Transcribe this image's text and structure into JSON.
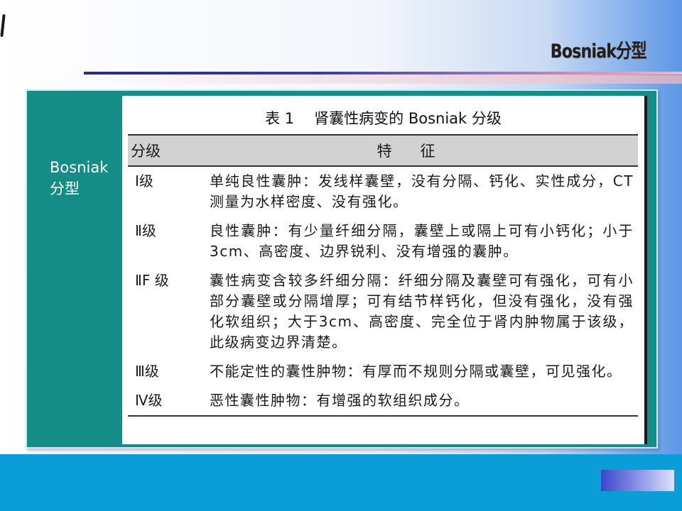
{
  "slide": {
    "title": "Bosniak分型",
    "side_label": "Bosniak 分型"
  },
  "table": {
    "caption_prefix": "表 1",
    "caption_text": "肾囊性病变的 Bosniak 分级",
    "headers": {
      "grade": "分级",
      "feature": "特征"
    },
    "rows": [
      {
        "grade": "Ⅰ级",
        "feature": "单纯良性囊肿：发线样囊壁，没有分隔、钙化、实性成分，CT测量为水样密度、没有强化。"
      },
      {
        "grade": "Ⅱ级",
        "feature": "良性囊肿：有少量纤细分隔，囊壁上或隔上可有小钙化；小于3cm、高密度、边界锐利、没有增强的囊肿。"
      },
      {
        "grade": "ⅡF 级",
        "feature": "囊性病变含较多纤细分隔：纤细分隔及囊壁可有强化，可有小部分囊壁或分隔增厚；可有结节样钙化，但没有强化，没有强化软组织；大于3cm、高密度、完全位于肾内肿物属于该级，此级病变边界清楚。"
      },
      {
        "grade": "Ⅲ级",
        "feature": "不能定性的囊性肿物：有厚而不规则分隔或囊壁，可见强化。"
      },
      {
        "grade": "Ⅳ级",
        "feature": "恶性囊性肿物：有增强的软组织成分。"
      }
    ]
  }
}
